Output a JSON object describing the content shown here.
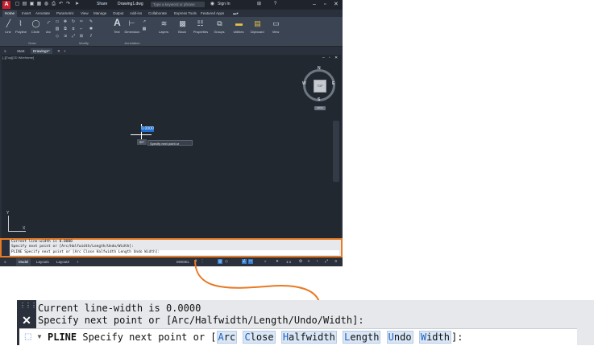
{
  "titlebar": {
    "logo": "A",
    "share": "Share",
    "document": "Drawing1.dwg",
    "search_placeholder": "Type a keyword or phrase",
    "signin": "Sign In"
  },
  "ribbon": {
    "tabs": [
      "Home",
      "Insert",
      "Annotate",
      "Parametric",
      "View",
      "Manage",
      "Output",
      "Add-ins",
      "Collaborate",
      "Express Tools",
      "Featured Apps"
    ],
    "active_tab": "Home",
    "draw_tools": [
      "Line",
      "Polyline",
      "Circle",
      "Arc"
    ],
    "annotation_tools": [
      "Text",
      "Dimension"
    ],
    "big_tools": [
      "Layers",
      "Block",
      "Properties",
      "Groups",
      "Utilities",
      "Clipboard",
      "View"
    ],
    "panel_titles": [
      "Draw",
      "Modify",
      "Annotation"
    ]
  },
  "filetabs": [
    "Start",
    "Drawing1*"
  ],
  "drawing": {
    "view_label": "[-][Top][2D Wireframe]",
    "viewcube_face": "TOP",
    "compass": {
      "n": "N",
      "s": "S",
      "e": "E",
      "w": "W"
    },
    "wcs": "WCS",
    "dyn_value": "0.0000",
    "angle": "90°",
    "tooltip": "Specify next point or",
    "axis_x": "X",
    "axis_y": "Y"
  },
  "command_small": {
    "line1": "Current line-width is 0.0000",
    "line2": "Specify next point or [Arc/Halfwidth/Length/Undo/Width]:",
    "prompt": "PLINE Specify next point or [Arc Close Halfwidth Length Undo Width]:"
  },
  "statusbar": {
    "layout_tabs": [
      "Model",
      "Layout1",
      "Layout2"
    ],
    "model_label": "MODEL",
    "scale": "1:1"
  },
  "command_zoom": {
    "line1": "Current line-width is 0.0000",
    "line2": "Specify next point or [Arc/Halfwidth/Length/Undo/Width]:",
    "cmd": "PLINE",
    "prompt_pre": " Specify next point or [",
    "options": [
      {
        "key": "A",
        "rest": "rc"
      },
      {
        "key": "C",
        "rest": "lose"
      },
      {
        "key": "H",
        "rest": "alfwidth"
      },
      {
        "key": "L",
        "rest": "ength"
      },
      {
        "key": "U",
        "rest": "ndo"
      },
      {
        "key": "W",
        "rest": "idth"
      }
    ],
    "prompt_post": "]:"
  },
  "colors": {
    "accent": "#e77a25",
    "dark_bg": "#2b313c",
    "canvas": "#212830",
    "highlight": "#1f6fd3"
  }
}
